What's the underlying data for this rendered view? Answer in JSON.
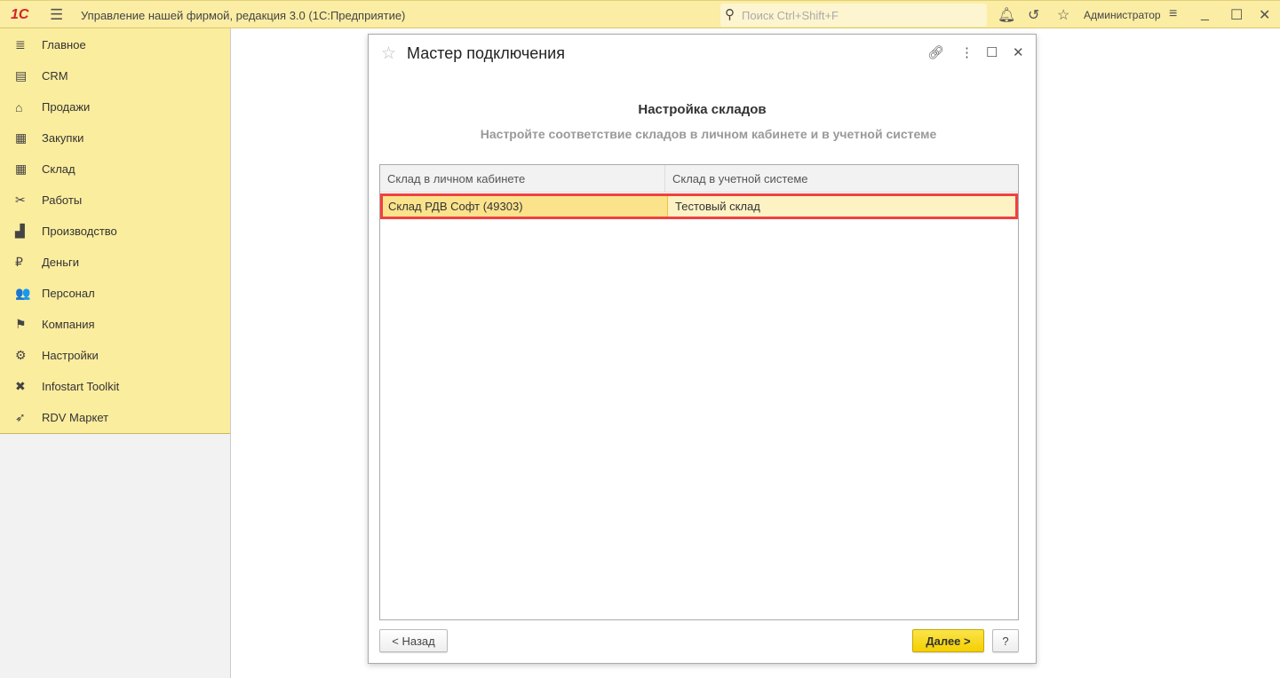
{
  "app": {
    "logo": "1С",
    "title": "Управление нашей фирмой, редакция 3.0  (1С:Предприятие)",
    "search_placeholder": "Поиск Ctrl+Shift+F",
    "user": "Администратор"
  },
  "sidebar": {
    "items": [
      {
        "label": "Главное",
        "icon": "≣"
      },
      {
        "label": "CRM",
        "icon": "▤"
      },
      {
        "label": "Продажи",
        "icon": "⌂"
      },
      {
        "label": "Закупки",
        "icon": "▦"
      },
      {
        "label": "Склад",
        "icon": "▦"
      },
      {
        "label": "Работы",
        "icon": "✂"
      },
      {
        "label": "Производство",
        "icon": "▟"
      },
      {
        "label": "Деньги",
        "icon": "₽"
      },
      {
        "label": "Персонал",
        "icon": "👥"
      },
      {
        "label": "Компания",
        "icon": "⚑"
      },
      {
        "label": "Настройки",
        "icon": "⚙"
      },
      {
        "label": "Infostart Toolkit",
        "icon": "✖"
      },
      {
        "label": "RDV Маркет",
        "icon": "➶"
      }
    ]
  },
  "dialog": {
    "title": "Мастер подключения",
    "heading": "Настройка складов",
    "subheading": "Настройте соответствие складов в личном кабинете и в учетной системе",
    "columns": [
      "Склад в личном кабинете",
      "Склад в учетной системе"
    ],
    "rows": [
      [
        "Склад РДВ Софт (49303)",
        "Тестовый склад"
      ]
    ],
    "back_label": "< Назад",
    "next_label": "Далее >",
    "help_label": "?"
  }
}
